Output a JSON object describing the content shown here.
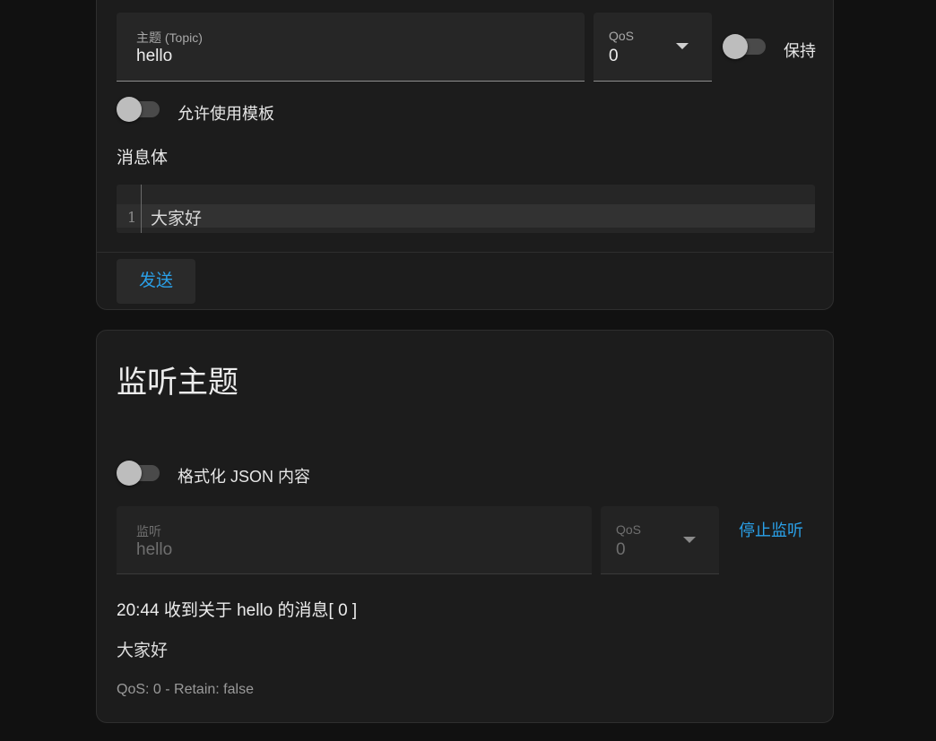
{
  "publish": {
    "topic_label": "主题 (Topic)",
    "topic_value": "hello",
    "qos_label": "QoS",
    "qos_value": "0",
    "retain_label": "保持",
    "retain_on": false,
    "template_label": "允许使用模板",
    "template_on": false,
    "payload_label": "消息体",
    "payload_lines": [
      {
        "no": "1",
        "text": "大家好"
      }
    ],
    "send_label": "发送"
  },
  "listen": {
    "title": "监听主题",
    "format_json_label": "格式化 JSON 内容",
    "format_json_on": false,
    "topic_label": "监听",
    "topic_value": "hello",
    "qos_label": "QoS",
    "qos_value": "0",
    "stop_label": "停止监听",
    "message": {
      "header": "20:44 收到关于 hello 的消息[ 0 ]",
      "body": "大家好",
      "meta": "QoS: 0 - Retain: false"
    }
  },
  "colors": {
    "accent": "#2aa0e8",
    "background": "#111111",
    "card": "#1c1c1c"
  }
}
